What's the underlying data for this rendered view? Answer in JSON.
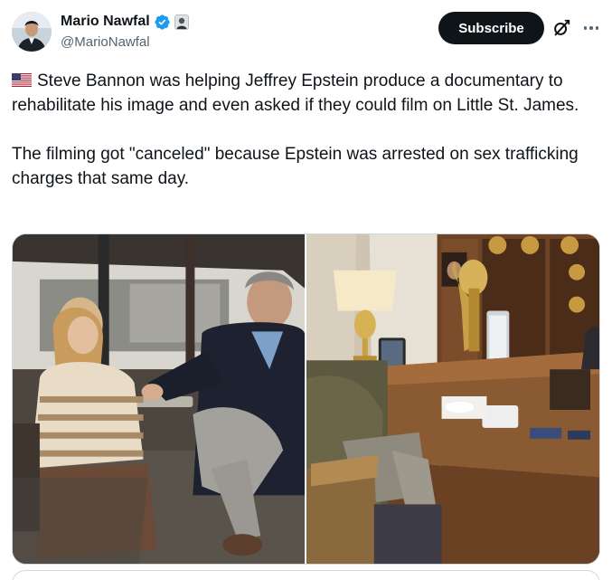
{
  "author": {
    "display_name": "Mario Nawfal",
    "handle": "@MarioNawfal",
    "avatar_icon": "profile-photo",
    "verified_icon": "verified-badge-icon",
    "affiliate_icon": "affiliate-badge-icon"
  },
  "actions": {
    "subscribe_label": "Subscribe",
    "grok_icon": "grok-icon",
    "more_icon": "more-icon"
  },
  "tweet": {
    "flag_icon": "us-flag-icon",
    "paragraph1": "Steve Bannon was helping Jeffrey Epstein produce a documentary to rehabilitate his image and even asked if they could film on Little St. James.",
    "paragraph2": "The filming got \"canceled\" because Epstein was arrested on sex trafficking charges that same day."
  },
  "media": [
    {
      "alt": "photo-outdoor-cafe"
    },
    {
      "alt": "photo-office-desk"
    }
  ],
  "colors": {
    "text": "#0f1419",
    "secondary": "#536471",
    "border": "#cfd9de",
    "verified": "#1d9bf0",
    "button_bg": "#0f1419"
  }
}
